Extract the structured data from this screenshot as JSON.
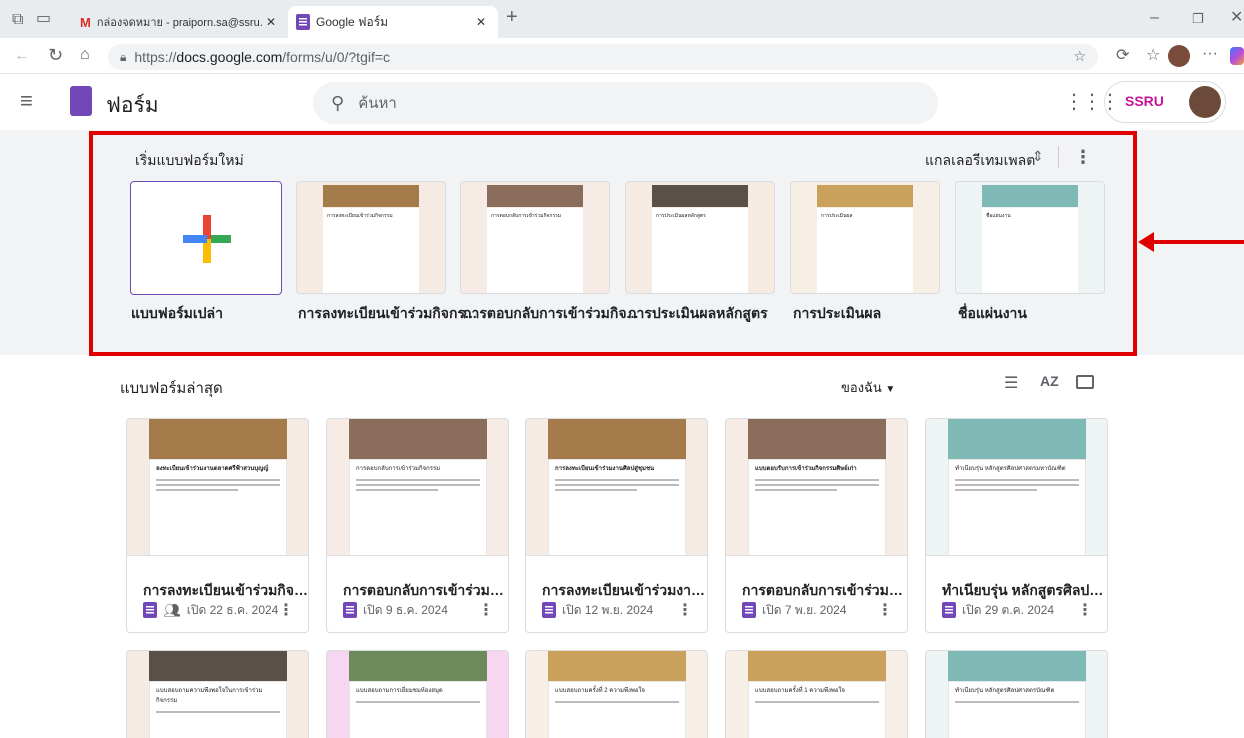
{
  "browser": {
    "tabs": [
      {
        "title": "กล่องจดหมาย - praiporn.sa@ssru.a",
        "icon": "gmail-icon"
      },
      {
        "title": "Google ฟอร์ม",
        "icon": "forms-icon"
      }
    ],
    "new_tab": "+",
    "url_prefix": "https://",
    "url_host": "docs.google.com",
    "url_path": "/forms/u/0/?tgif=c"
  },
  "app": {
    "name": "ฟอร์ม",
    "search_placeholder": "ค้นหา",
    "account_badge": "SSRU"
  },
  "templates": {
    "heading": "เริ่มแบบฟอร์มใหม่",
    "gallery_label": "แกลเลอรีเทมเพลต",
    "items": [
      {
        "label": "แบบฟอร์มเปล่า",
        "header_color": "",
        "thumb_title": ""
      },
      {
        "label": "การลงทะเบียนเข้าร่วมกิจกร...",
        "header_color": "#a67b4c",
        "thumb_title": "การลงทะเบียนเข้าร่วมกิจกรรม"
      },
      {
        "label": "การตอบกลับการเข้าร่วมกิจ...",
        "header_color": "#8a6d5a",
        "thumb_title": "การตอบกลับการเข้าร่วมกิจกรรม"
      },
      {
        "label": "การประเมินผลหลักสูตร",
        "header_color": "#5a5048",
        "thumb_title": "การประเมินผลหลักสูตร"
      },
      {
        "label": "การประเมินผล",
        "header_color": "#c9a15a",
        "thumb_title": "การประเมินผล"
      },
      {
        "label": "ชื่อแผ่นงาน",
        "header_color": "#7fb9b5",
        "thumb_title": "ชื่อแผ่นงาน"
      }
    ]
  },
  "recent": {
    "heading": "แบบฟอร์มล่าสุด",
    "owner_filter": "ของฉัน",
    "forms": [
      {
        "title": "การลงทะเบียนเข้าร่วมกิจกรรม",
        "meta": "เปิด 22 ธ.ค. 2024",
        "shared": true,
        "header_color": "#a67b4c",
        "thumb_title": "ลงทะเบียนเข้าร่วมงานตลาดศรีฟ้าสวนบุญญ์"
      },
      {
        "title": "การตอบกลับการเข้าร่วมกิจกรรม",
        "meta": "เปิด 9 ธ.ค. 2024",
        "shared": false,
        "header_color": "#8a6d5a",
        "thumb_title": "การตอบกลับการเข้าร่วมกิจกรรม"
      },
      {
        "title": "การลงทะเบียนเข้าร่วมงานศินสู่...",
        "meta": "เปิด 12 พ.ย. 2024",
        "shared": false,
        "header_color": "#a67b4c",
        "thumb_title": "การลงทะเบียนเข้าร่วมงานศิลปสู่ชุมชน"
      },
      {
        "title": "การตอบกลับการเข้าร่วมศิษย์เ...",
        "meta": "เปิด 7 พ.ย. 2024",
        "shared": false,
        "header_color": "#8a6d5a",
        "thumb_title": "แบบตอบรับการเข้าร่วมกิจกรรมศิษย์เก่า"
      },
      {
        "title": "ทำเนียบรุ่น หลักสูตรศิลปศาสต...",
        "meta": "เปิด 29 ต.ค. 2024",
        "shared": false,
        "header_color": "#7fb9b5",
        "thumb_title": "ทำเนียบรุ่น หลักสูตรศิลปศาสตรมหาบัณฑิต"
      }
    ],
    "row2": [
      {
        "header_color": "#5a5048",
        "bg": "#f6ebe3",
        "thumb_title": "แบบสอบถามความพึงพอใจในการเข้าร่วมกิจกรรม"
      },
      {
        "header_color": "#6c8a5a",
        "bg": "#f7d6f2",
        "thumb_title": "แบบสอบถามการเยี่ยมชมห้องสมุด"
      },
      {
        "header_color": "#c9a15a",
        "bg": "#f7efe6",
        "thumb_title": "แบบสอบถามครั้งที่ 2 ความพึงพอใจ"
      },
      {
        "header_color": "#c9a15a",
        "bg": "#f7efe6",
        "thumb_title": "แบบสอบถามครั้งที่ 1 ความพึงพอใจ"
      },
      {
        "header_color": "#7fb9b5",
        "bg": "#eef4f4",
        "thumb_title": "ทำเนียบรุ่น หลักสูตรศิลปศาสตรบัณฑิต"
      }
    ]
  },
  "colors": {
    "forms_purple": "#7248b9",
    "highlight_red": "#e00000"
  }
}
